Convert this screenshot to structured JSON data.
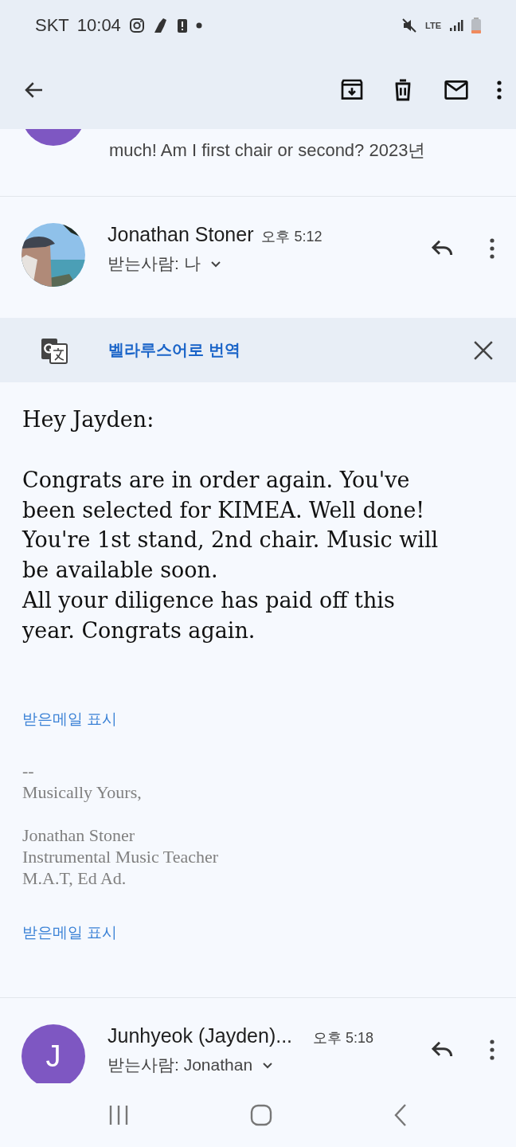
{
  "status_bar": {
    "carrier": "SKT",
    "time": "10:04",
    "network": "LTE"
  },
  "toolbar": {
    "actions": [
      {
        "kind": "archive"
      },
      {
        "kind": "delete"
      },
      {
        "kind": "mark_unread"
      },
      {
        "kind": "more"
      }
    ]
  },
  "previous_message": {
    "snippet": "much! Am I first chair or second? 2023년"
  },
  "message": {
    "sender": "Jonathan Stoner",
    "time": "오후 5:12",
    "recipient": "받는사람: 나",
    "translate_bar": {
      "label": "벨라루스어로 번역"
    },
    "body": [
      {
        "lines": [
          "Hey Jayden:"
        ]
      },
      {
        "lines": [
          "Congrats are in order again. You've",
          "been selected for KIMEA. Well done!",
          "You're 1st stand, 2nd chair. Music will",
          "be available soon.",
          "All your diligence has paid off this",
          "year. Congrats again."
        ]
      }
    ],
    "show_quoted_1": "받은메일 표시",
    "signature": [
      {
        "lines": [
          "--",
          "Musically Yours,"
        ]
      },
      {
        "lines": [
          "Jonathan Stoner",
          "Instrumental Music Teacher",
          "M.A.T, Ed Ad."
        ]
      }
    ],
    "show_quoted_2": "받은메일 표시"
  },
  "next_message": {
    "avatar_letter": "J",
    "sender": "Junhyeok (Jayden)...",
    "time": "오후 5:18",
    "recipient": "받는사람: Jonathan"
  }
}
